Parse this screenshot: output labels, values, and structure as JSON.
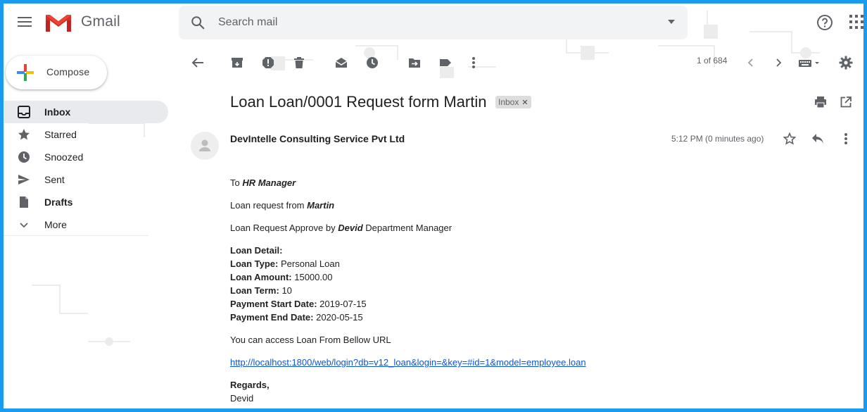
{
  "header": {
    "app_name": "Gmail",
    "search_placeholder": "Search mail"
  },
  "sidebar": {
    "compose_label": "Compose",
    "items": [
      {
        "label": "Inbox",
        "icon": "inbox-icon",
        "active": true,
        "bold": true
      },
      {
        "label": "Starred",
        "icon": "star-icon"
      },
      {
        "label": "Snoozed",
        "icon": "clock-icon"
      },
      {
        "label": "Sent",
        "icon": "send-icon"
      },
      {
        "label": "Drafts",
        "icon": "draft-icon",
        "bold": true
      },
      {
        "label": "More",
        "icon": "chevron-down-icon"
      }
    ]
  },
  "toolbar": {
    "pager": "1 of 684"
  },
  "email": {
    "subject": "Loan Loan/0001 Request form Martin",
    "label": "Inbox",
    "sender": "DevIntelle Consulting Service Pvt Ltd",
    "time": "5:12 PM (0 minutes ago)",
    "to_prefix": "To ",
    "to_name": "HR Manager",
    "request_prefix": "Loan request from ",
    "request_name": "Martin",
    "approve_prefix": "Loan Request Approve by ",
    "approve_name": "Devid",
    "approve_suffix": " Department Manager",
    "detail_heading": "Loan Detail:",
    "details": [
      {
        "key": "Loan Type:",
        "value": " Personal Loan"
      },
      {
        "key": "Loan Amount:",
        "value": " 15000.00"
      },
      {
        "key": "Loan Term:",
        "value": " 10"
      },
      {
        "key": "Payment Start Date:",
        "value": " 2019-07-15"
      },
      {
        "key": "Payment End Date:",
        "value": " 2020-05-15"
      }
    ],
    "access_text": "You can access Loan From Bellow URL",
    "url": "http://localhost:1800/web/login?db=v12_loan&login=&key=#id=1&model=employee.loan",
    "regards": "Regards,",
    "signature": "Devid"
  },
  "colors": {
    "border": "#1a9bf0",
    "active_nav": "#e8eaed",
    "link": "#1155cc",
    "search_bg": "#f1f3f4"
  }
}
